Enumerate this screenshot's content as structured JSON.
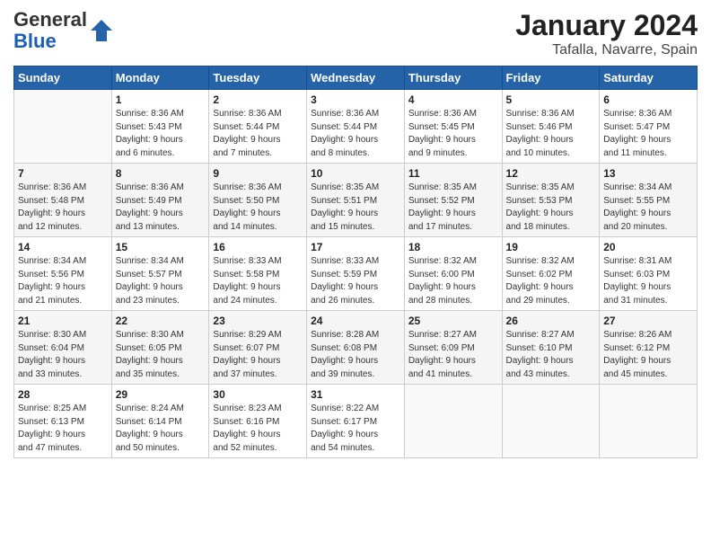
{
  "header": {
    "logo_line1": "General",
    "logo_line2": "Blue",
    "month": "January 2024",
    "location": "Tafalla, Navarre, Spain"
  },
  "weekdays": [
    "Sunday",
    "Monday",
    "Tuesday",
    "Wednesday",
    "Thursday",
    "Friday",
    "Saturday"
  ],
  "weeks": [
    [
      {
        "day": "",
        "info": ""
      },
      {
        "day": "1",
        "info": "Sunrise: 8:36 AM\nSunset: 5:43 PM\nDaylight: 9 hours\nand 6 minutes."
      },
      {
        "day": "2",
        "info": "Sunrise: 8:36 AM\nSunset: 5:44 PM\nDaylight: 9 hours\nand 7 minutes."
      },
      {
        "day": "3",
        "info": "Sunrise: 8:36 AM\nSunset: 5:44 PM\nDaylight: 9 hours\nand 8 minutes."
      },
      {
        "day": "4",
        "info": "Sunrise: 8:36 AM\nSunset: 5:45 PM\nDaylight: 9 hours\nand 9 minutes."
      },
      {
        "day": "5",
        "info": "Sunrise: 8:36 AM\nSunset: 5:46 PM\nDaylight: 9 hours\nand 10 minutes."
      },
      {
        "day": "6",
        "info": "Sunrise: 8:36 AM\nSunset: 5:47 PM\nDaylight: 9 hours\nand 11 minutes."
      }
    ],
    [
      {
        "day": "7",
        "info": "Sunrise: 8:36 AM\nSunset: 5:48 PM\nDaylight: 9 hours\nand 12 minutes."
      },
      {
        "day": "8",
        "info": "Sunrise: 8:36 AM\nSunset: 5:49 PM\nDaylight: 9 hours\nand 13 minutes."
      },
      {
        "day": "9",
        "info": "Sunrise: 8:36 AM\nSunset: 5:50 PM\nDaylight: 9 hours\nand 14 minutes."
      },
      {
        "day": "10",
        "info": "Sunrise: 8:35 AM\nSunset: 5:51 PM\nDaylight: 9 hours\nand 15 minutes."
      },
      {
        "day": "11",
        "info": "Sunrise: 8:35 AM\nSunset: 5:52 PM\nDaylight: 9 hours\nand 17 minutes."
      },
      {
        "day": "12",
        "info": "Sunrise: 8:35 AM\nSunset: 5:53 PM\nDaylight: 9 hours\nand 18 minutes."
      },
      {
        "day": "13",
        "info": "Sunrise: 8:34 AM\nSunset: 5:55 PM\nDaylight: 9 hours\nand 20 minutes."
      }
    ],
    [
      {
        "day": "14",
        "info": "Sunrise: 8:34 AM\nSunset: 5:56 PM\nDaylight: 9 hours\nand 21 minutes."
      },
      {
        "day": "15",
        "info": "Sunrise: 8:34 AM\nSunset: 5:57 PM\nDaylight: 9 hours\nand 23 minutes."
      },
      {
        "day": "16",
        "info": "Sunrise: 8:33 AM\nSunset: 5:58 PM\nDaylight: 9 hours\nand 24 minutes."
      },
      {
        "day": "17",
        "info": "Sunrise: 8:33 AM\nSunset: 5:59 PM\nDaylight: 9 hours\nand 26 minutes."
      },
      {
        "day": "18",
        "info": "Sunrise: 8:32 AM\nSunset: 6:00 PM\nDaylight: 9 hours\nand 28 minutes."
      },
      {
        "day": "19",
        "info": "Sunrise: 8:32 AM\nSunset: 6:02 PM\nDaylight: 9 hours\nand 29 minutes."
      },
      {
        "day": "20",
        "info": "Sunrise: 8:31 AM\nSunset: 6:03 PM\nDaylight: 9 hours\nand 31 minutes."
      }
    ],
    [
      {
        "day": "21",
        "info": "Sunrise: 8:30 AM\nSunset: 6:04 PM\nDaylight: 9 hours\nand 33 minutes."
      },
      {
        "day": "22",
        "info": "Sunrise: 8:30 AM\nSunset: 6:05 PM\nDaylight: 9 hours\nand 35 minutes."
      },
      {
        "day": "23",
        "info": "Sunrise: 8:29 AM\nSunset: 6:07 PM\nDaylight: 9 hours\nand 37 minutes."
      },
      {
        "day": "24",
        "info": "Sunrise: 8:28 AM\nSunset: 6:08 PM\nDaylight: 9 hours\nand 39 minutes."
      },
      {
        "day": "25",
        "info": "Sunrise: 8:27 AM\nSunset: 6:09 PM\nDaylight: 9 hours\nand 41 minutes."
      },
      {
        "day": "26",
        "info": "Sunrise: 8:27 AM\nSunset: 6:10 PM\nDaylight: 9 hours\nand 43 minutes."
      },
      {
        "day": "27",
        "info": "Sunrise: 8:26 AM\nSunset: 6:12 PM\nDaylight: 9 hours\nand 45 minutes."
      }
    ],
    [
      {
        "day": "28",
        "info": "Sunrise: 8:25 AM\nSunset: 6:13 PM\nDaylight: 9 hours\nand 47 minutes."
      },
      {
        "day": "29",
        "info": "Sunrise: 8:24 AM\nSunset: 6:14 PM\nDaylight: 9 hours\nand 50 minutes."
      },
      {
        "day": "30",
        "info": "Sunrise: 8:23 AM\nSunset: 6:16 PM\nDaylight: 9 hours\nand 52 minutes."
      },
      {
        "day": "31",
        "info": "Sunrise: 8:22 AM\nSunset: 6:17 PM\nDaylight: 9 hours\nand 54 minutes."
      },
      {
        "day": "",
        "info": ""
      },
      {
        "day": "",
        "info": ""
      },
      {
        "day": "",
        "info": ""
      }
    ]
  ]
}
